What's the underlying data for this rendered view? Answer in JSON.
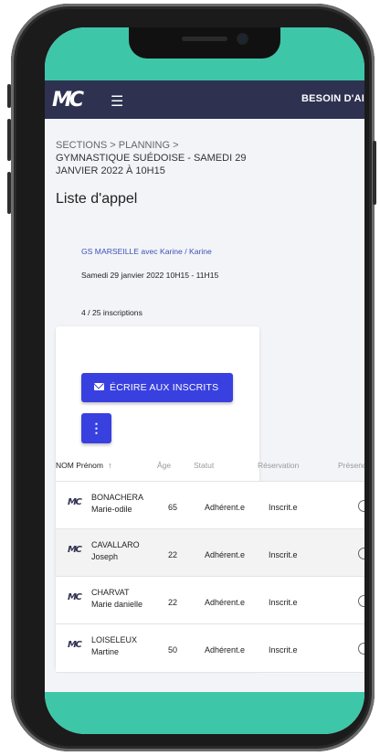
{
  "app": {
    "logo_text": "MC",
    "help_label": "BESOIN D'AIDE",
    "menu_icon": "hamburger-icon",
    "colors": {
      "accent": "#3940e0",
      "appbar": "#2e3250",
      "teal": "#3ec6a8",
      "link": "#3f51b5"
    }
  },
  "breadcrumb": {
    "sections": "SECTIONS",
    "sep1": ">",
    "planning": "PLANNING",
    "sep2": ">",
    "current": "GYMNASTIQUE SUÉDOISE - SAMEDI 29 JANVIER 2022 À 10H15"
  },
  "page": {
    "title": "Liste d'appel"
  },
  "session": {
    "course": "GS MARSEILLE avec Karine / Karine",
    "date": "Samedi 29 janvier 2022 10H15 - 11H15",
    "registrations": "4 / 25 inscriptions"
  },
  "actions": {
    "email_label": "ÉCRIRE AUX INSCRITS",
    "email_icon": "mail-icon",
    "more_label": "⋮",
    "more_icon": "more-vert-icon"
  },
  "table": {
    "headers": {
      "name": "NOM Prénom",
      "sort_arrow": "↑",
      "age": "Âge",
      "status": "Statut",
      "reservation": "Réservation",
      "presence": "Présence"
    },
    "rows": [
      {
        "last": "BONACHERA",
        "first": "Marie-odile",
        "age": "65",
        "status": "Adhérent.e",
        "reservation": "Inscrit.e"
      },
      {
        "last": "CAVALLARO",
        "first": "Joseph",
        "age": "22",
        "status": "Adhérent.e",
        "reservation": "Inscrit.e"
      },
      {
        "last": "CHARVAT",
        "first": "Marie danielle",
        "age": "22",
        "status": "Adhérent.e",
        "reservation": "Inscrit.e"
      },
      {
        "last": "LOISELEUX",
        "first": "Martine",
        "age": "50",
        "status": "Adhérent.e",
        "reservation": "Inscrit.e"
      }
    ]
  }
}
